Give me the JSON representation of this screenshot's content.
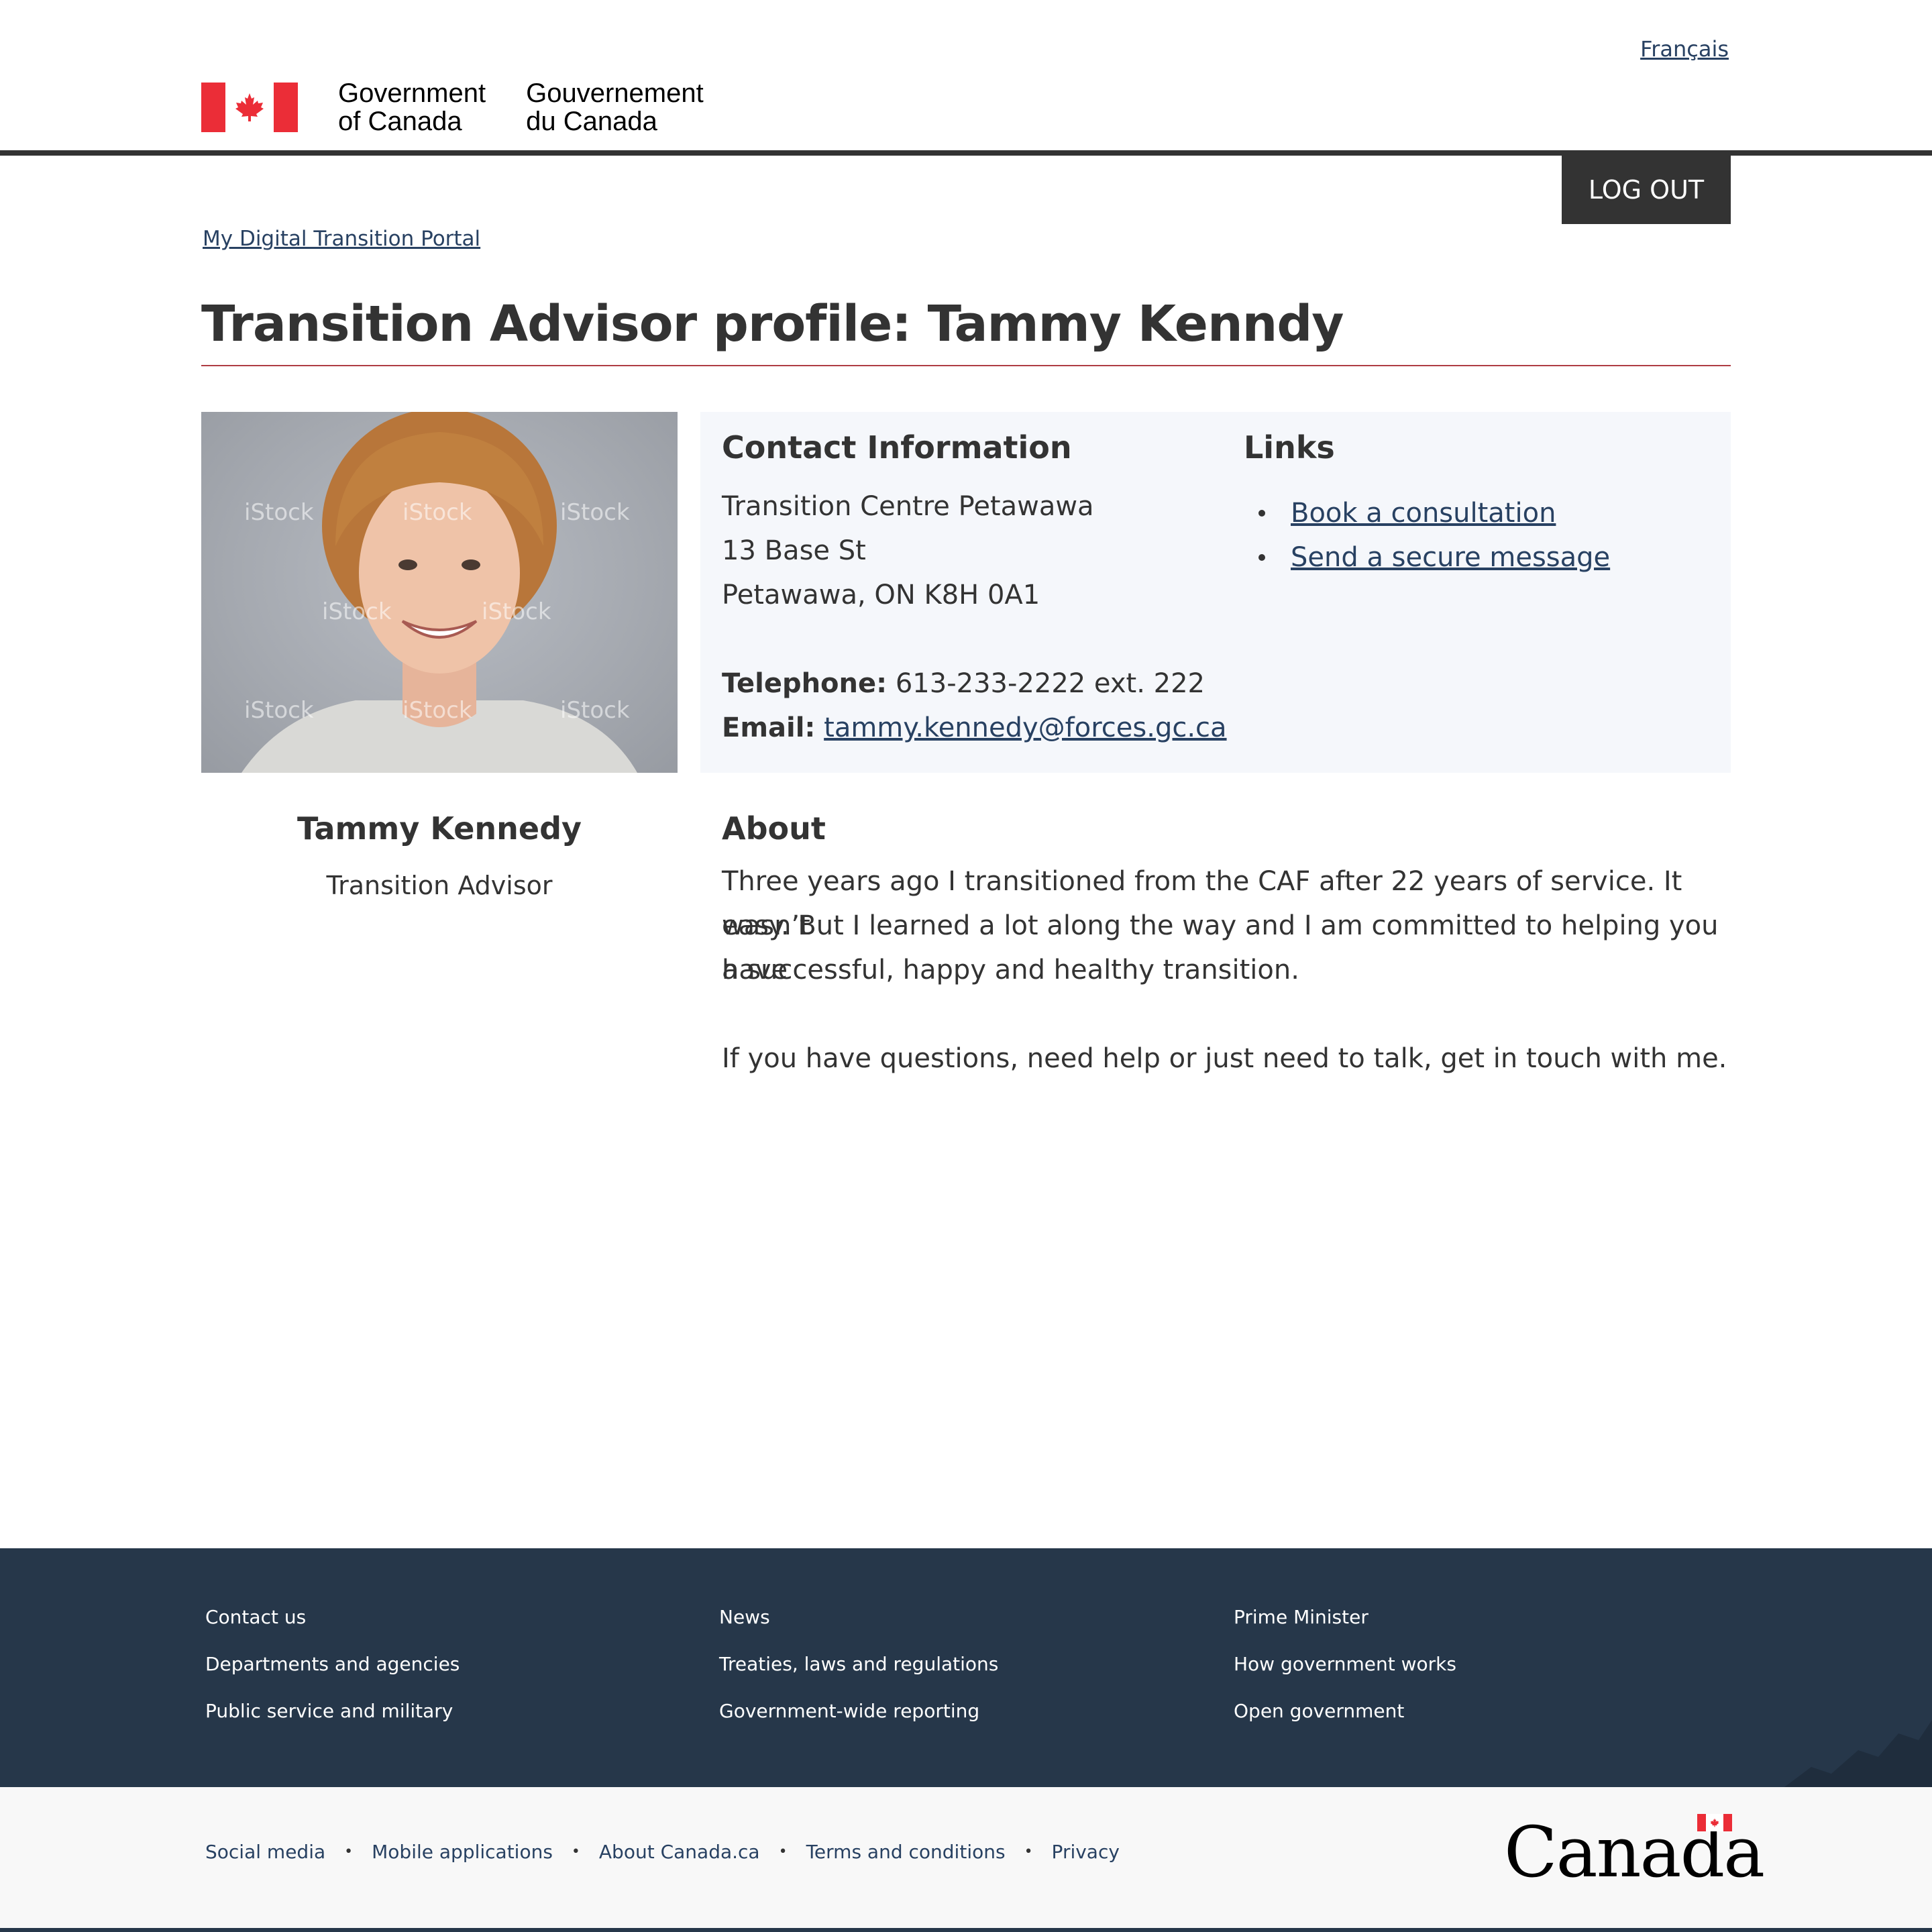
{
  "header": {
    "language_link": "Français",
    "signature_en": "Government\nof Canada",
    "signature_fr": "Gouvernement\ndu Canada",
    "logout_label": "LOG OUT"
  },
  "breadcrumb": {
    "portal": "My Digital Transition Portal"
  },
  "page": {
    "title": "Transition Advisor profile: Tammy Kenndy"
  },
  "profile": {
    "photo_watermark": "iStock",
    "name": "Tammy Kennedy",
    "role": "Transition Advisor"
  },
  "contact": {
    "heading": "Contact Information",
    "address": [
      "Transition Centre Petawawa",
      "13 Base St",
      "Petawawa, ON K8H 0A1"
    ],
    "telephone_label": "Telephone:",
    "telephone_value": "613-233-2222 ext. 222",
    "email_label": "Email:",
    "email_value": "tammy.kennedy@forces.gc.ca"
  },
  "links": {
    "heading": "Links",
    "items": [
      "Book a consultation",
      "Send a secure message"
    ]
  },
  "about": {
    "heading": "About",
    "paragraph1_lines": [
      "Three years ago I transitioned from the CAF after 22 years of service.  It wasn’t",
      "easy. But I learned a lot along the way and I am committed to helping you have",
      "a successful, happy and healthy transition."
    ],
    "paragraph2": "If you have questions, need help or just need to talk, get in touch with me."
  },
  "footer": {
    "columns": [
      [
        "Contact us",
        "Departments and agencies",
        "Public service and military"
      ],
      [
        "News",
        "Treaties, laws and regulations",
        "Government-wide reporting"
      ],
      [
        "Prime Minister",
        "How government works",
        "Open government"
      ]
    ],
    "sub_links": [
      "Social media",
      "Mobile applications",
      "About Canada.ca",
      "Terms and conditions",
      "Privacy"
    ],
    "wordmark": "Canada"
  },
  "colors": {
    "link": "#284162",
    "footer_bg": "#26374a",
    "flag_red": "#eb2d37",
    "title_rule": "#af3c43"
  }
}
